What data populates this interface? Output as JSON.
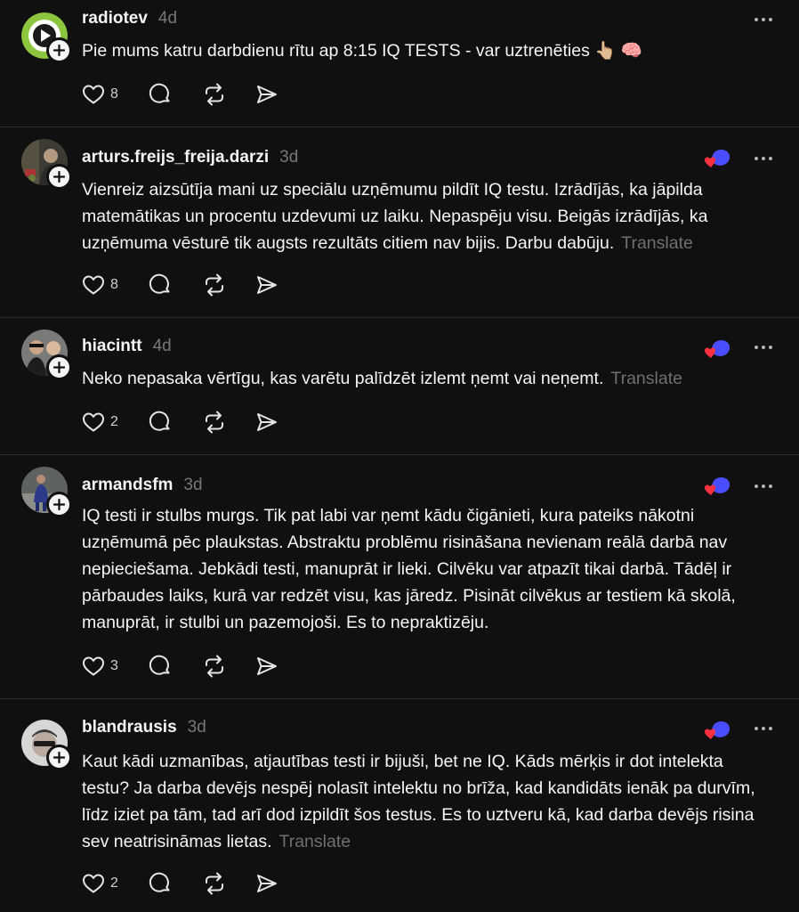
{
  "posts": [
    {
      "username": "radiotev",
      "time": "4d",
      "text": "Pie mums katru darbdienu rītu ap 8:15 IQ TESTS - var uztrenēties 👆🏼 🧠",
      "translate": "",
      "likes": "8",
      "avatar_icon": "play-icon",
      "has_reaction": false
    },
    {
      "username": "arturs.freijs_freija.darzi",
      "time": "3d",
      "text": "Vienreiz aizsūtīja mani uz speciālu uzņēmumu pildīt IQ testu. Izrādījās, ka jāpilda matemātikas un procentu uzdevumi uz laiku. Nepaspēju visu. Beigās izrādījās, ka uzņēmuma vēsturē tik augsts rezultāts citiem nav bijis. Darbu dabūju.",
      "translate": "Translate",
      "likes": "8",
      "avatar_icon": "photo",
      "has_reaction": true
    },
    {
      "username": "hiacintt",
      "time": "4d",
      "text": "Neko nepasaka vērtīgu, kas varētu palīdzēt izlemt ņemt vai neņemt.",
      "translate": "Translate",
      "likes": "2",
      "avatar_icon": "photo",
      "has_reaction": true
    },
    {
      "username": "armandsfm",
      "time": "3d",
      "text": "IQ testi ir stulbs murgs. Tik pat labi var ņemt kādu čigānieti, kura pateiks nākotni uzņēmumā pēc plaukstas. Abstraktu problēmu risināšana nevienam reālā darbā nav nepieciešama. Jebkādi testi, manuprāt ir lieki. Cilvēku var atpazīt tikai darbā. Tādēļ ir pārbaudes laiks, kurā var redzēt visu, kas jāredz. Pisināt cilvēkus ar testiem kā skolā, manuprāt, ir stulbi un pazemojoši. Es to nepraktizēju.",
      "translate": "",
      "likes": "3",
      "avatar_icon": "photo",
      "has_reaction": true
    },
    {
      "username": "blandrausis",
      "time": "3d",
      "text": "Kaut kādi uzmanības, atjautības testi ir bijuši, bet ne IQ. Kāds mērķis ir dot intelekta testu? Ja darba devējs nespēj nolasīt intelektu no brīža, kad kandidāts ienāk pa durvīm, līdz iziet pa tām, tad arī dod izpildīt šos testus. Es to uztveru kā, kad darba devējs risina sev neatrisināmas lietas.",
      "translate": "Translate",
      "likes": "2",
      "avatar_icon": "photo",
      "has_reaction": true
    }
  ],
  "colors": {
    "background": "#101010",
    "text": "#f3f5f7",
    "muted": "#777777",
    "divider": "#2a2a2a",
    "reaction_heart": "#ff3040",
    "reaction_blob": "#4a4dff"
  }
}
